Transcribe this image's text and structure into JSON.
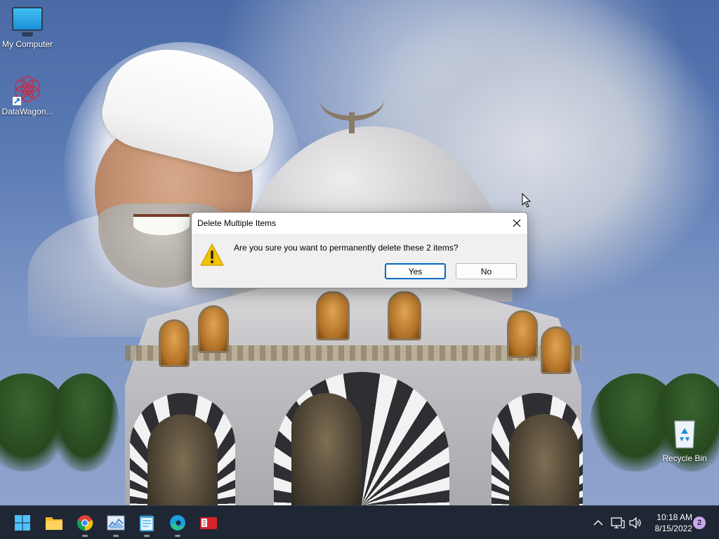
{
  "desktop": {
    "icons": [
      {
        "label": "My Computer"
      },
      {
        "label": "DataWagon..."
      },
      {
        "label": "Recycle Bin"
      }
    ]
  },
  "dialog": {
    "title": "Delete Multiple Items",
    "message": "Are you sure you want to permanently delete these 2 items?",
    "yes_label": "Yes",
    "no_label": "No",
    "icon": "warning-icon"
  },
  "taskbar": {
    "apps": [
      {
        "name": "start-icon"
      },
      {
        "name": "file-explorer-icon"
      },
      {
        "name": "chrome-icon"
      },
      {
        "name": "task-manager-icon"
      },
      {
        "name": "notepad-icon"
      },
      {
        "name": "edge-icon"
      },
      {
        "name": "red-app-icon"
      }
    ],
    "tray": {
      "time": "10:18 AM",
      "date": "8/15/2022",
      "notification_count": "2"
    }
  },
  "colors": {
    "taskbar_bg": "#1f2734",
    "accent": "#0067c0",
    "warning": "#f5c400"
  }
}
